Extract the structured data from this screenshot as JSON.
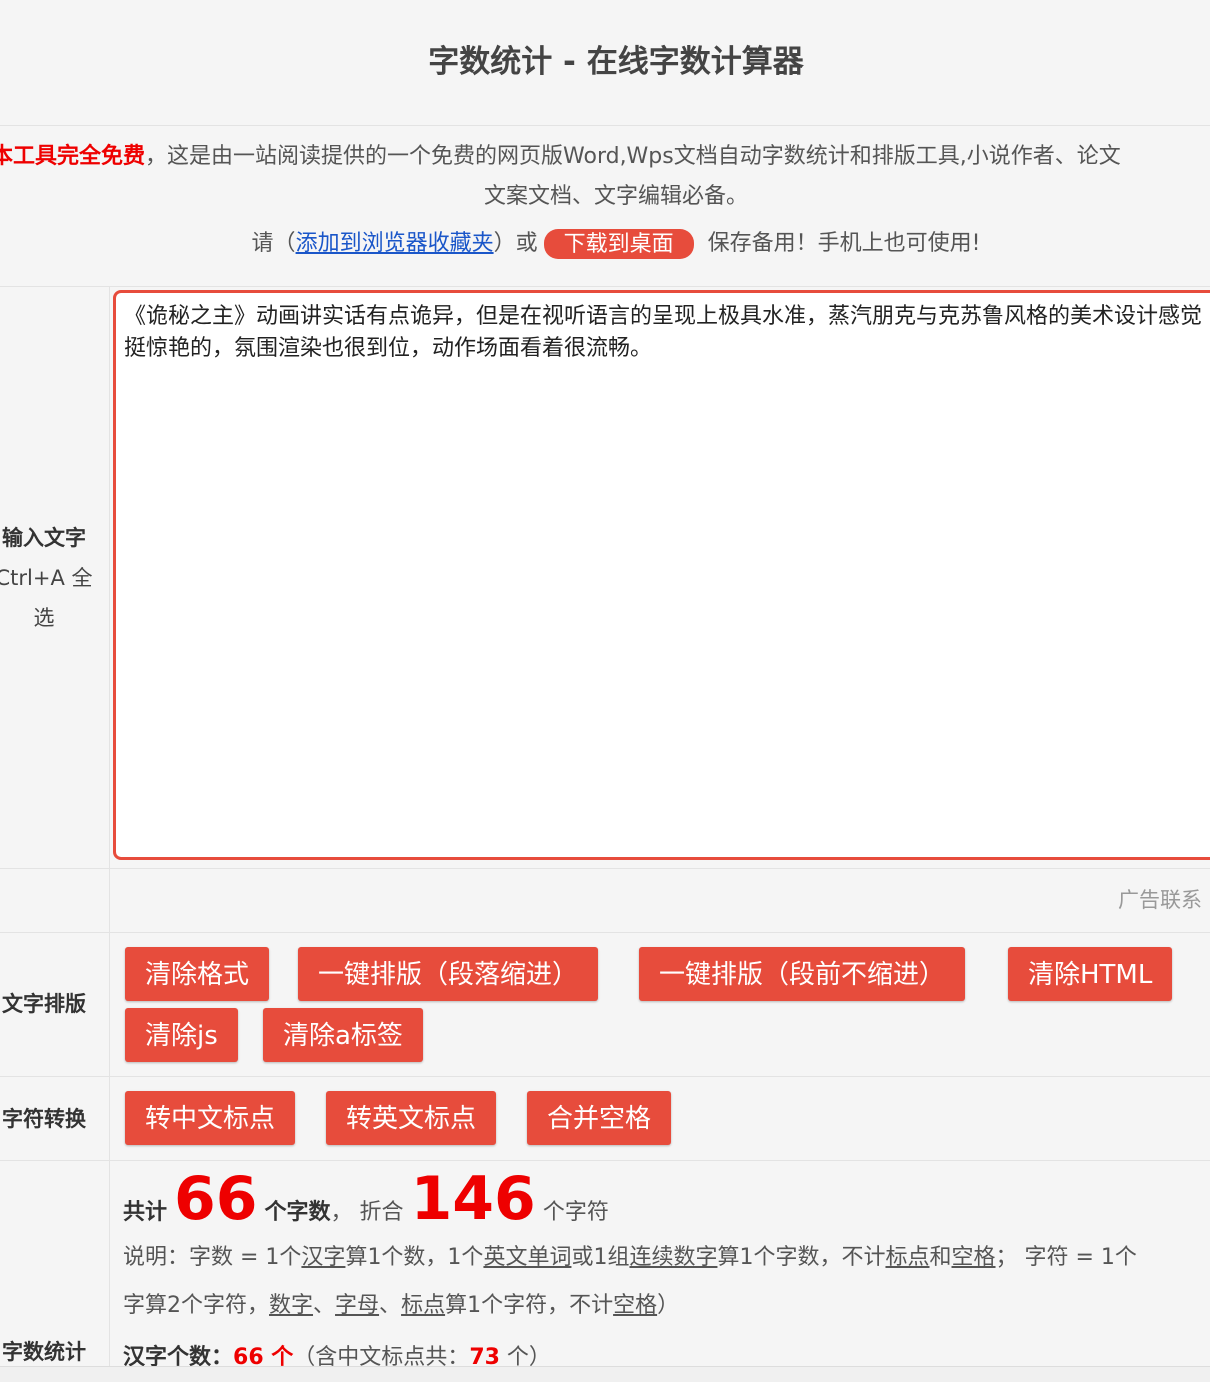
{
  "header": {
    "title": "字数统计 - 在线字数计算器"
  },
  "intro": {
    "free_text": "本工具完全免费",
    "line1_rest": "，这是由一站阅读提供的一个免费的网页版Word,Wps文档自动字数统计和排版工具,小说作者、论文",
    "line2": "文案文档、文字编辑必备。",
    "please": "请（",
    "bookmark_link": "添加到浏览器收藏夹",
    "or": "）或",
    "download_btn": "下载到桌面",
    "save_note": "保存备用！手机上也可使用!"
  },
  "input": {
    "label_title": "输入文字",
    "label_hint": "Ctrl+A 全选",
    "text": "《诡秘之主》动画讲实话有点诡异，但是在视听语言的呈现上极具水准，蒸汽朋克与克苏鲁风格的美术设计感觉挺惊艳的，氛围渲染也很到位，动作场面看着很流畅。"
  },
  "ad": {
    "text": "广告联系"
  },
  "format": {
    "label": "文字排版",
    "buttons": [
      "清除格式",
      "一键排版（段落缩进）",
      "一键排版（段前不缩进）",
      "清除HTML",
      "清除js",
      "清除a标签"
    ]
  },
  "convert": {
    "label": "字符转换",
    "buttons": [
      "转中文标点",
      "转英文标点",
      "合并空格"
    ]
  },
  "stats": {
    "label": "字数统计",
    "total_prefix": "共计",
    "word_count": "66",
    "word_unit": "个字数",
    "sep": "，",
    "equiv": "折合",
    "char_count": "146",
    "char_unit": "个字符",
    "note_a": "说明：字数 = 1个",
    "note_hanzi": "汉字",
    "note_b": "算1个数，1个",
    "note_word": "英文单词",
    "note_c": "或1组",
    "note_digits": "连续数字",
    "note_d": "算1个字数，不计",
    "note_punct": "标点",
    "note_and": "和",
    "note_space": "空格",
    "note_e": "；  字符 = 1个",
    "note2_a": "字算2个字符，",
    "note2_digit": "数字",
    "note2_sep1": "、",
    "note2_letter": "字母",
    "note2_sep2": "、",
    "note2_punct": "标点",
    "note2_b": "算1个字符，不计",
    "note2_space": "空格",
    "note2_c": "）",
    "hanzi_label": "汉字个数：",
    "hanzi_count": "66 个",
    "hanzi_paren": "（含中文标点共：",
    "hanzi_punct_count": "73",
    "hanzi_paren_end": " 个）"
  }
}
